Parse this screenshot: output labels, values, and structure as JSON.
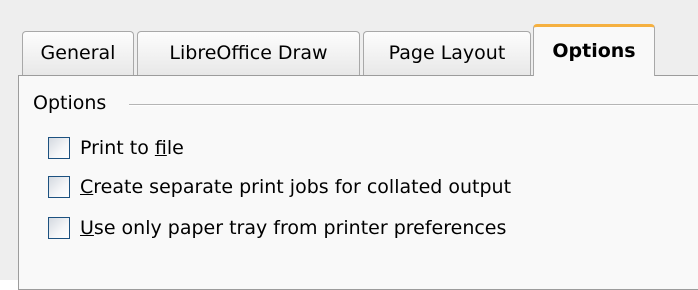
{
  "tabs": [
    {
      "label": "General",
      "active": false
    },
    {
      "label": "LibreOffice Draw",
      "active": false
    },
    {
      "label": "Page Layout",
      "active": false
    },
    {
      "label": "Options",
      "active": true
    }
  ],
  "options_group": {
    "title": "Options",
    "items": [
      {
        "pre": "Print to ",
        "mnemonic": "f",
        "post": "ile",
        "checked": false
      },
      {
        "pre": "",
        "mnemonic": "C",
        "post": "reate separate print jobs for collated output",
        "checked": false
      },
      {
        "pre": "",
        "mnemonic": "U",
        "post": "se only paper tray from printer preferences",
        "checked": false
      }
    ]
  },
  "colors": {
    "active_tab_accent": "#f5b040",
    "checkbox_border": "#1c5180",
    "panel_background": "#f9f9f9"
  }
}
